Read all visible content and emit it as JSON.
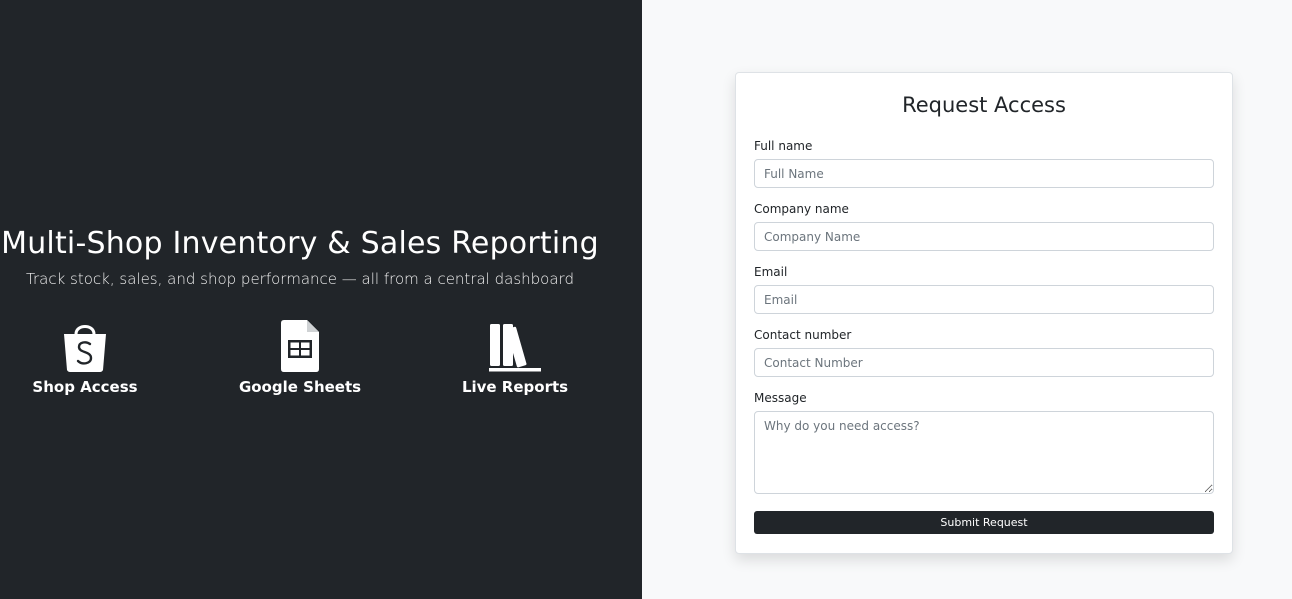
{
  "hero": {
    "title": "Multi-Shop Inventory & Sales Reporting",
    "subtitle": "Track stock, sales, and shop performance — all from a central dashboard",
    "features": [
      {
        "label": "Shop Access",
        "icon": "shopping-bag-icon"
      },
      {
        "label": "Google Sheets",
        "icon": "spreadsheet-icon"
      },
      {
        "label": "Live Reports",
        "icon": "books-icon"
      }
    ]
  },
  "form": {
    "title": "Request Access",
    "fields": {
      "full_name": {
        "label": "Full name",
        "placeholder": "Full Name",
        "value": ""
      },
      "company": {
        "label": "Company name",
        "placeholder": "Company Name",
        "value": ""
      },
      "email": {
        "label": "Email",
        "placeholder": "Email",
        "value": ""
      },
      "contact": {
        "label": "Contact number",
        "placeholder": "Contact Number",
        "value": ""
      },
      "message": {
        "label": "Message",
        "placeholder": "Why do you need access?",
        "value": ""
      }
    },
    "submit_label": "Submit Request"
  },
  "colors": {
    "left_bg": "#212529",
    "right_bg": "#f8f9fa",
    "button_bg": "#212529"
  }
}
